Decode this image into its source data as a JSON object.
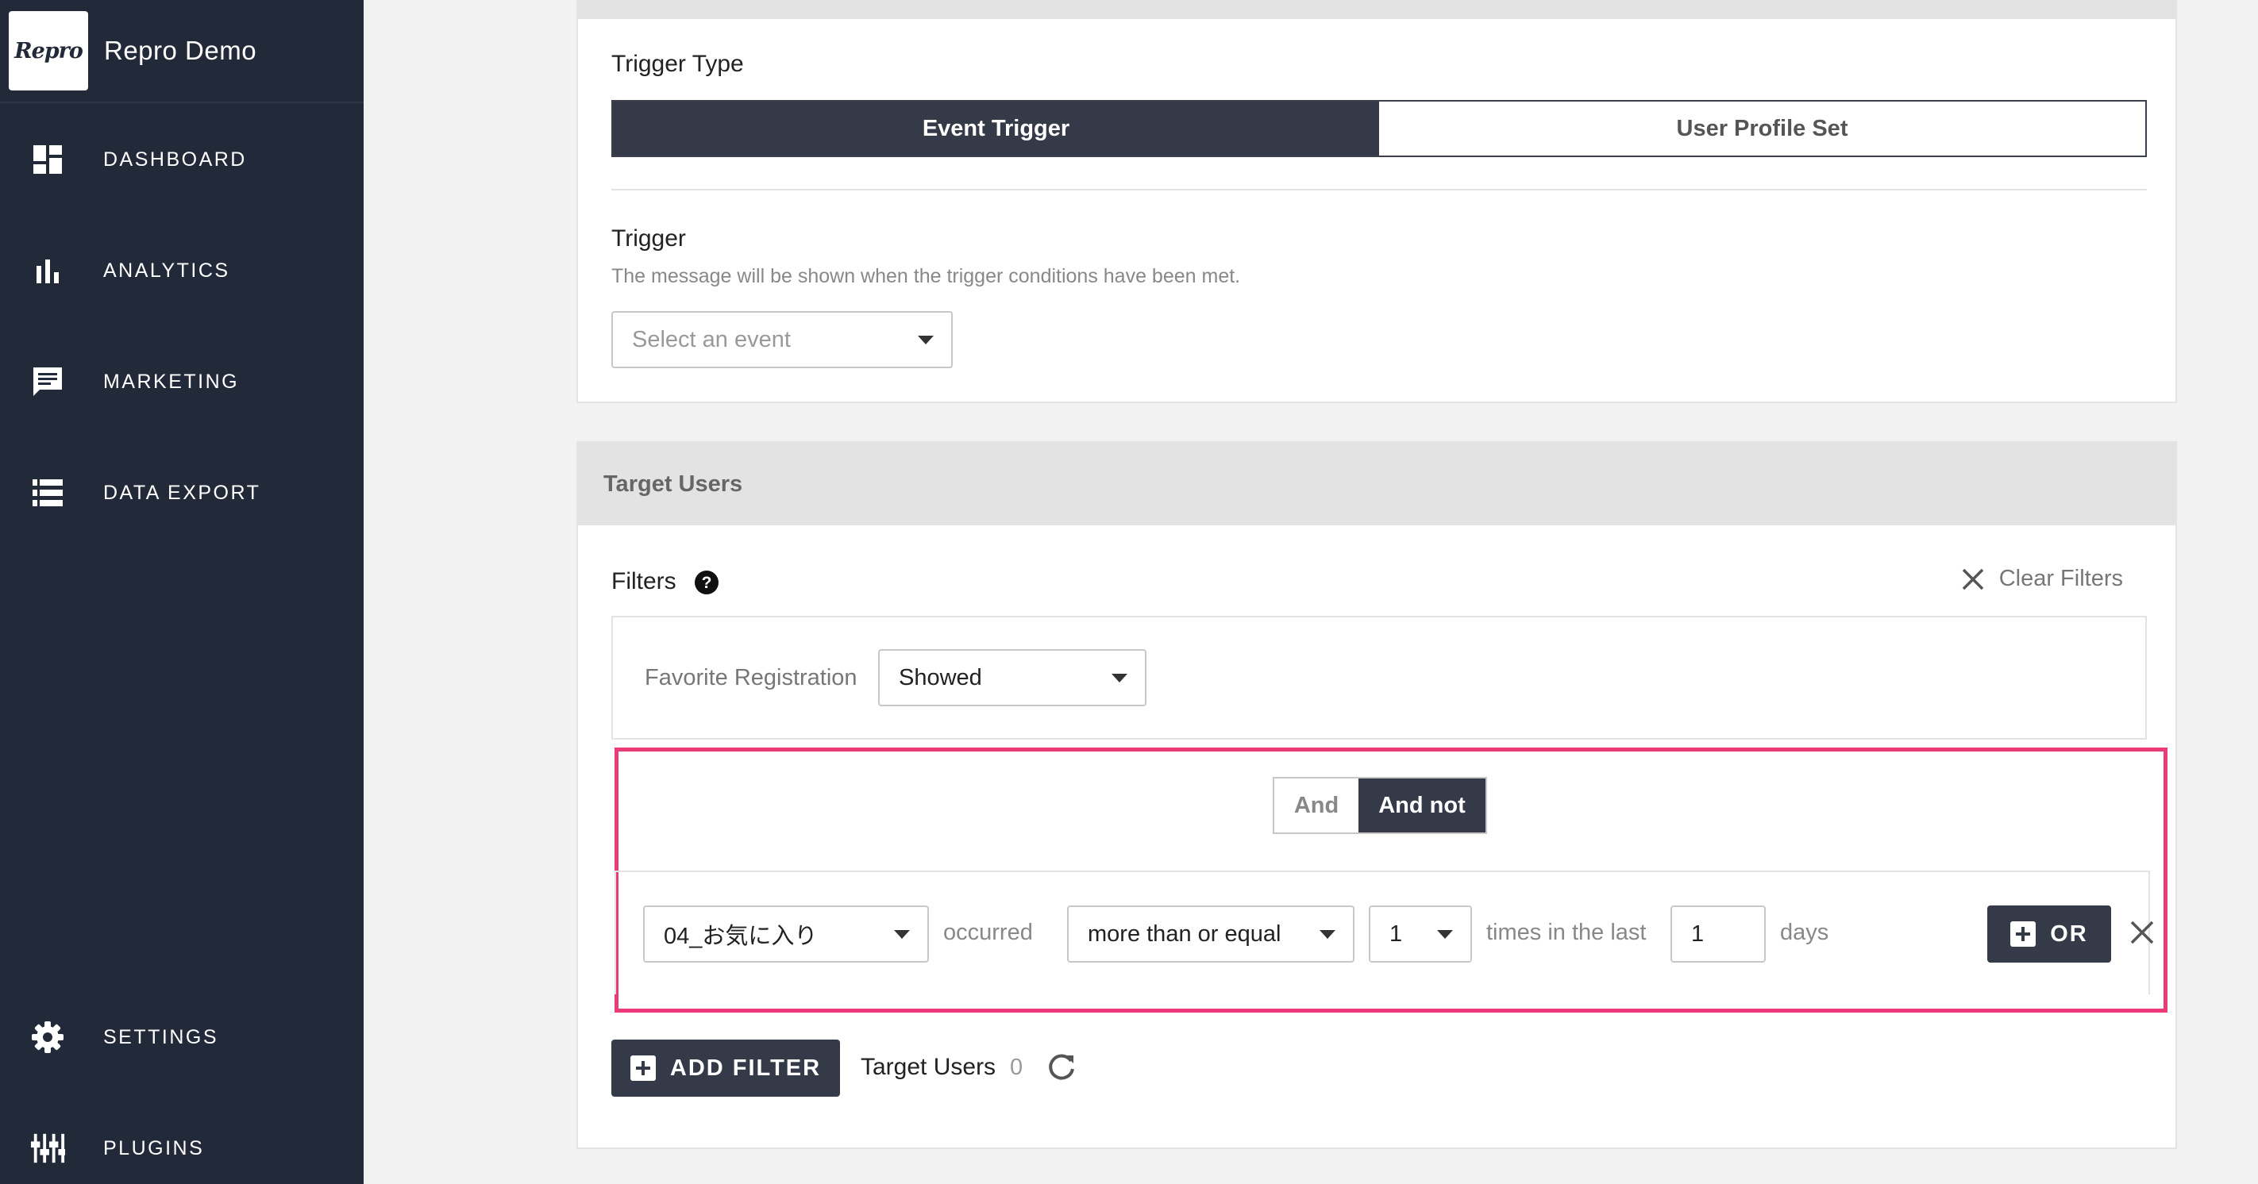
{
  "sidebar": {
    "logo_text": "Repro",
    "app_name": "Repro Demo",
    "items": [
      {
        "label": "DASHBOARD",
        "icon": "dashboard-icon"
      },
      {
        "label": "ANALYTICS",
        "icon": "bar-chart-icon"
      },
      {
        "label": "MARKETING",
        "icon": "message-icon"
      },
      {
        "label": "DATA EXPORT",
        "icon": "list-icon"
      },
      {
        "label": "SETTINGS",
        "icon": "gear-icon"
      },
      {
        "label": "PLUGINS",
        "icon": "plugins-icon"
      }
    ]
  },
  "trigger_section": {
    "trigger_type_label": "Trigger Type",
    "tabs": [
      "Event Trigger",
      "User Profile Set"
    ],
    "active_tab": "Event Trigger",
    "trigger_label": "Trigger",
    "trigger_description": "The message will be shown when the trigger conditions have been met.",
    "event_select_placeholder": "Select an event"
  },
  "target_users": {
    "header": "Target Users",
    "filters_label": "Filters",
    "clear_filters_label": "Clear Filters",
    "filter1": {
      "name": "Favorite Registration",
      "value": "Showed"
    },
    "logic": {
      "options": [
        "And",
        "And not"
      ],
      "selected": "And not"
    },
    "condition": {
      "event": "04_お気に入り",
      "occurred_text": "occurred",
      "comparison": "more than or equal",
      "count": "1",
      "times_text": "times in the last",
      "period": "1",
      "days_text": "days",
      "or_button": "OR"
    },
    "add_filter_label": "ADD FILTER",
    "target_users_label": "Target Users",
    "target_users_count": "0"
  },
  "colors": {
    "sidebar_bg": "#222a3a",
    "dark_button": "#343a47",
    "highlight": "#ea3a7a"
  }
}
